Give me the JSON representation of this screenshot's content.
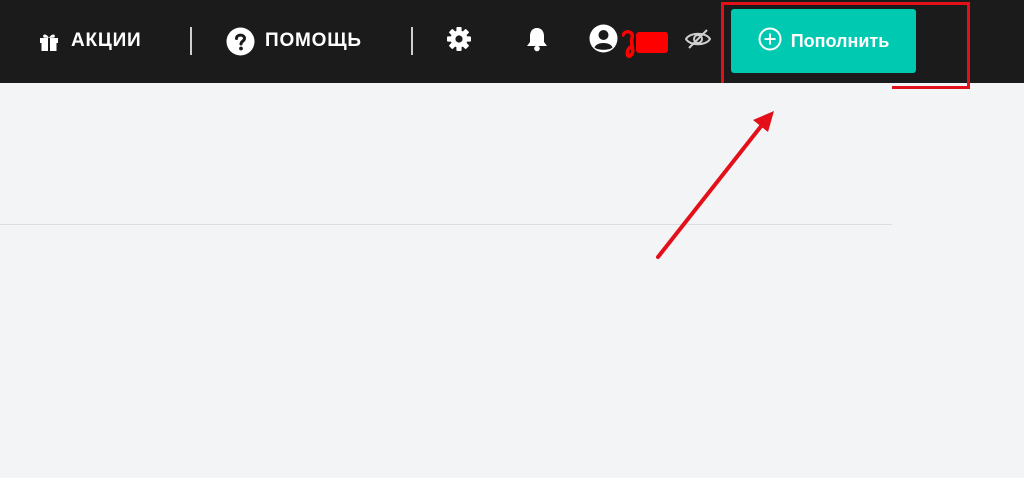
{
  "header": {
    "promo_label": "АКЦИИ",
    "help_label": "ПОМОЩЬ",
    "topup_label": "Пополнить"
  },
  "icons": {
    "promo": "gift-icon",
    "help": "question-circle-icon",
    "settings": "gear-icon",
    "notifications": "bell-icon",
    "account": "user-circle-icon",
    "visibility": "eye-slash-icon",
    "topup": "plus-circle-icon"
  },
  "colors": {
    "header_bg": "#1b1b1b",
    "topup_button": "#00c9b1",
    "annotation": "#e3101a",
    "page_bg": "#f3f4f6"
  }
}
